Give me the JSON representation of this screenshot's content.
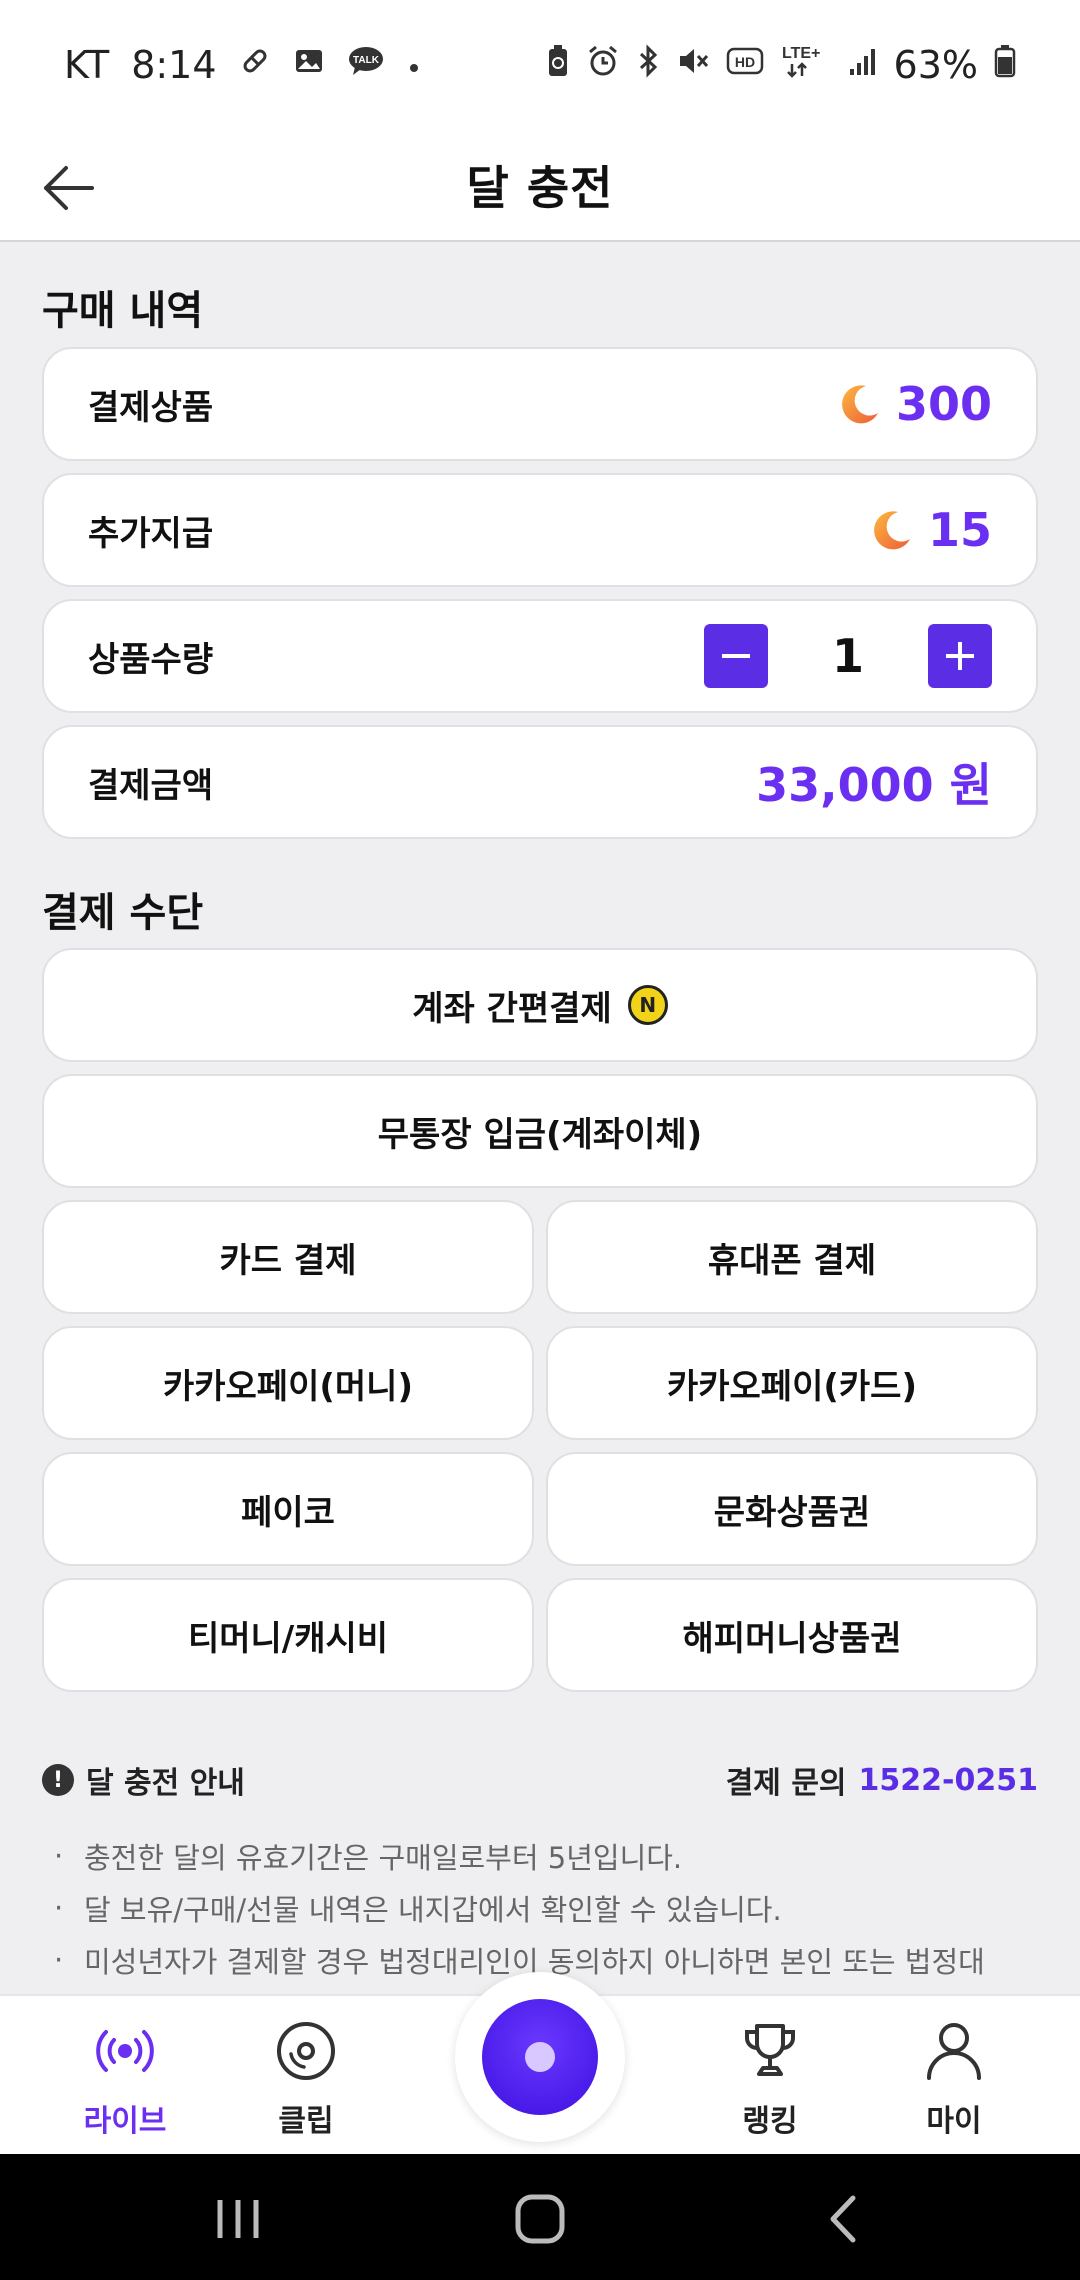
{
  "status": {
    "carrier": "KT",
    "time": "8:14",
    "battery": "63%",
    "left_icons": [
      "pill-icon",
      "image-icon",
      "talk-icon",
      "dot-icon"
    ],
    "right_icons": [
      "battery-saver-icon",
      "alarm-icon",
      "bluetooth-icon",
      "mute-icon",
      "hd-icon",
      "lte-icon",
      "signal-icon",
      "battery-icon"
    ],
    "talk_label": "TALK",
    "hd_label": "HD",
    "lte_label": "LTE+"
  },
  "header": {
    "title": "달 충전"
  },
  "purchase": {
    "section_title": "구매 내역",
    "product_label": "결제상품",
    "product_value": "300",
    "bonus_label": "추가지급",
    "bonus_value": "15",
    "quantity_label": "상품수량",
    "quantity_value": "1",
    "amount_label": "결제금액",
    "amount_value": "33,000 원"
  },
  "payment": {
    "section_title": "결제 수단",
    "methods": [
      "계좌 간편결제",
      "무통장 입금(계좌이체)",
      "카드 결제",
      "휴대폰 결제",
      "카카오페이(머니)",
      "카카오페이(카드)",
      "페이코",
      "문화상품권",
      "티머니/캐시비",
      "해피머니상품권"
    ],
    "badge": "N"
  },
  "notice": {
    "title": "달 충전 안내",
    "warn_symbol": "!",
    "inquiry_label": "결제 문의",
    "phone": "1522-0251",
    "bullet": "·",
    "items": [
      "충전한 달의 유효기간은 구매일로부터 5년입니다.",
      "달 보유/구매/선물 내역은 내지갑에서 확인할 수 있습니다.",
      "미성년자가 결제할 경우 법정대리인이 동의하지 아니하면 본인 또는 법정대"
    ]
  },
  "nav": {
    "items": [
      {
        "label": "라이브",
        "icon": "broadcast-icon"
      },
      {
        "label": "클립",
        "icon": "disc-icon"
      },
      {
        "label": "랭킹",
        "icon": "trophy-icon"
      },
      {
        "label": "마이",
        "icon": "person-icon"
      }
    ],
    "center_icon": "record-icon"
  },
  "colors": {
    "accent": "#6a2ff0",
    "button": "#5b2ee6",
    "moon": "#f4a340",
    "badge": "#f3d21a"
  }
}
